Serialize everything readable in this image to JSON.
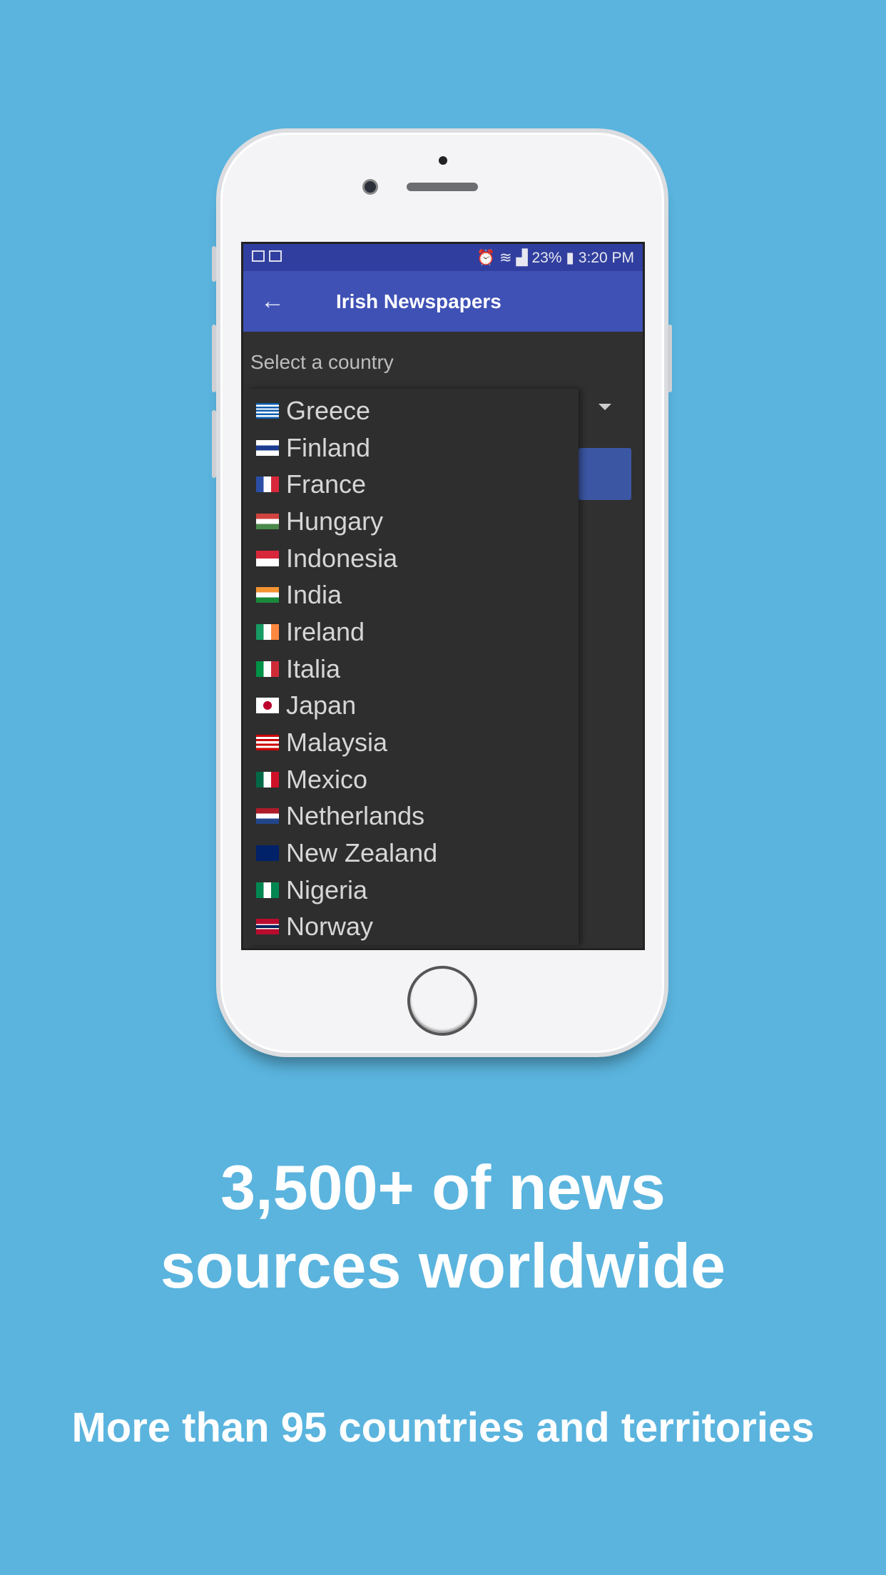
{
  "status_bar": {
    "battery": "23%",
    "time": "3:20 PM",
    "icons": [
      "image-icon",
      "activity-icon",
      "alarm-icon",
      "wifi-icon",
      "signal-icon",
      "battery-icon"
    ]
  },
  "app_bar": {
    "title": "Irish Newspapers",
    "back_icon": "arrow-left-icon"
  },
  "form": {
    "label": "Select a country"
  },
  "countries": [
    {
      "name": "Greece",
      "flag": "linear-gradient(#0d5eaf 0 11%,#fff 11% 22%,#0d5eaf 22% 33%,#fff 33% 44%,#0d5eaf 44% 55%,#fff 55% 66%,#0d5eaf 66% 77%,#fff 77% 88%,#0d5eaf 88%)"
    },
    {
      "name": "Finland",
      "flag": "linear-gradient(#fff 35%,#1a3b8f 35% 65%,#fff 65%)"
    },
    {
      "name": "France",
      "flag": "linear-gradient(90deg,#2b4ea6 33%,#fff 33% 66%,#d8273a 66%)"
    },
    {
      "name": "Hungary",
      "flag": "linear-gradient(#d0433f 33%,#fff 33% 66%,#4a8a4a 66%)"
    },
    {
      "name": "Indonesia",
      "flag": "linear-gradient(#d8273a 50%,#fff 50%)"
    },
    {
      "name": "India",
      "flag": "linear-gradient(#f39331 33%,#fff 33% 66%,#1a8a3a 66%)"
    },
    {
      "name": "Ireland",
      "flag": "linear-gradient(90deg,#169b62 33%,#fff 33% 66%,#ff883e 66%)"
    },
    {
      "name": "Italia",
      "flag": "linear-gradient(90deg,#009246 33%,#fff 33% 66%,#ce2b37 66%)"
    },
    {
      "name": "Japan",
      "flag": "radial-gradient(circle,#bc002d 30%,#fff 32%)"
    },
    {
      "name": "Malaysia",
      "flag": "linear-gradient(#c00 14%,#fff 14% 28%,#c00 28% 42%,#fff 42% 56%,#c00 56% 70%,#fff 70% 84%,#c00 84%)"
    },
    {
      "name": "Mexico",
      "flag": "linear-gradient(90deg,#006847 33%,#fff 33% 66%,#ce1126 66%)"
    },
    {
      "name": "Netherlands",
      "flag": "linear-gradient(#ae1c28 33%,#fff 33% 66%,#21468b 66%)"
    },
    {
      "name": "New Zealand",
      "flag": "linear-gradient(#012169,#012169)"
    },
    {
      "name": "Nigeria",
      "flag": "linear-gradient(90deg,#008751 33%,#fff 33% 66%,#008751 66%)"
    },
    {
      "name": "Norway",
      "flag": "linear-gradient(#ba0c2f 35%,#fff 35% 42%,#00205b 42% 58%,#fff 58% 65%,#ba0c2f 65%)"
    }
  ],
  "promo": {
    "headline_line1": "3,500+ of news",
    "headline_line2": "sources worldwide",
    "subtitle": "More than 95 countries and territories"
  },
  "colors": {
    "background": "#5ab4de",
    "status_bar": "#303f9f",
    "app_bar": "#3f51b5"
  }
}
